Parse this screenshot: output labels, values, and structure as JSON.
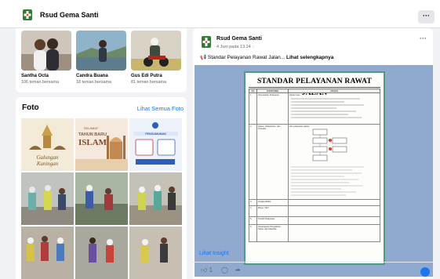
{
  "header": {
    "page_name": "Rsud Gema Santi",
    "more_label": "···"
  },
  "friends": [
    {
      "name": "Santha Octa",
      "mutual": "106 teman bersama"
    },
    {
      "name": "Candra Buana",
      "mutual": "18 teman bersama"
    },
    {
      "name": "Gus Edi Putra",
      "mutual": "81 teman bersama"
    }
  ],
  "photos": {
    "title": "Foto",
    "see_all": "Lihat Semua Foto",
    "thumbs": [
      {
        "caption": "Selamat Hari Raya Galungan & Kuningan",
        "text_1": "Galungan",
        "text_2": "Kuningan"
      },
      {
        "caption": "Selamat Tahun Baru Islam",
        "text_1": "SELAMAT",
        "text_2": "TAHUN BARU",
        "text_3": "ISLAM"
      },
      {
        "caption": "Pengumuman",
        "text_1": "PENGUMUMAN"
      }
    ]
  },
  "post": {
    "author": "Rsud Gema Santi",
    "date": "4 Juni pada 13.24",
    "privacy_icon": "globe-icon",
    "text": "Standar Pelayanan Rawat Jalan...",
    "see_more": "Lihat selengkapnya",
    "more_label": "···",
    "doc_title": "STANDAR PELAYANAN RAWAT JALAN",
    "table_headers": [
      "NO",
      "KOMPONEN",
      "URAIAN"
    ],
    "table_rows": [
      {
        "no": "1.",
        "komponen": "Persyaratan Pelayanan",
        "uraian": "Pasien baru"
      },
      {
        "no": "2.",
        "komponen": "Sistem, Mekanisme, dan Prosedur",
        "uraian": "Alur pelayanan pasien"
      },
      {
        "no": "3.",
        "komponen": "Jangka Waktu",
        "uraian": ""
      },
      {
        "no": "4.",
        "komponen": "Biaya / Tarif",
        "uraian": ""
      },
      {
        "no": "5.",
        "komponen": "Produk Pelayanan",
        "uraian": ""
      },
      {
        "no": "6.",
        "komponen": "Penanganan Pengaduan, Saran, dan Masukan",
        "uraian": ""
      }
    ],
    "insight": "Lihat Insight",
    "like_count": "1"
  },
  "colors": {
    "accent": "#1877f2",
    "doc_border": "#4d9c7c",
    "media_bg": "#8fa9cf"
  }
}
